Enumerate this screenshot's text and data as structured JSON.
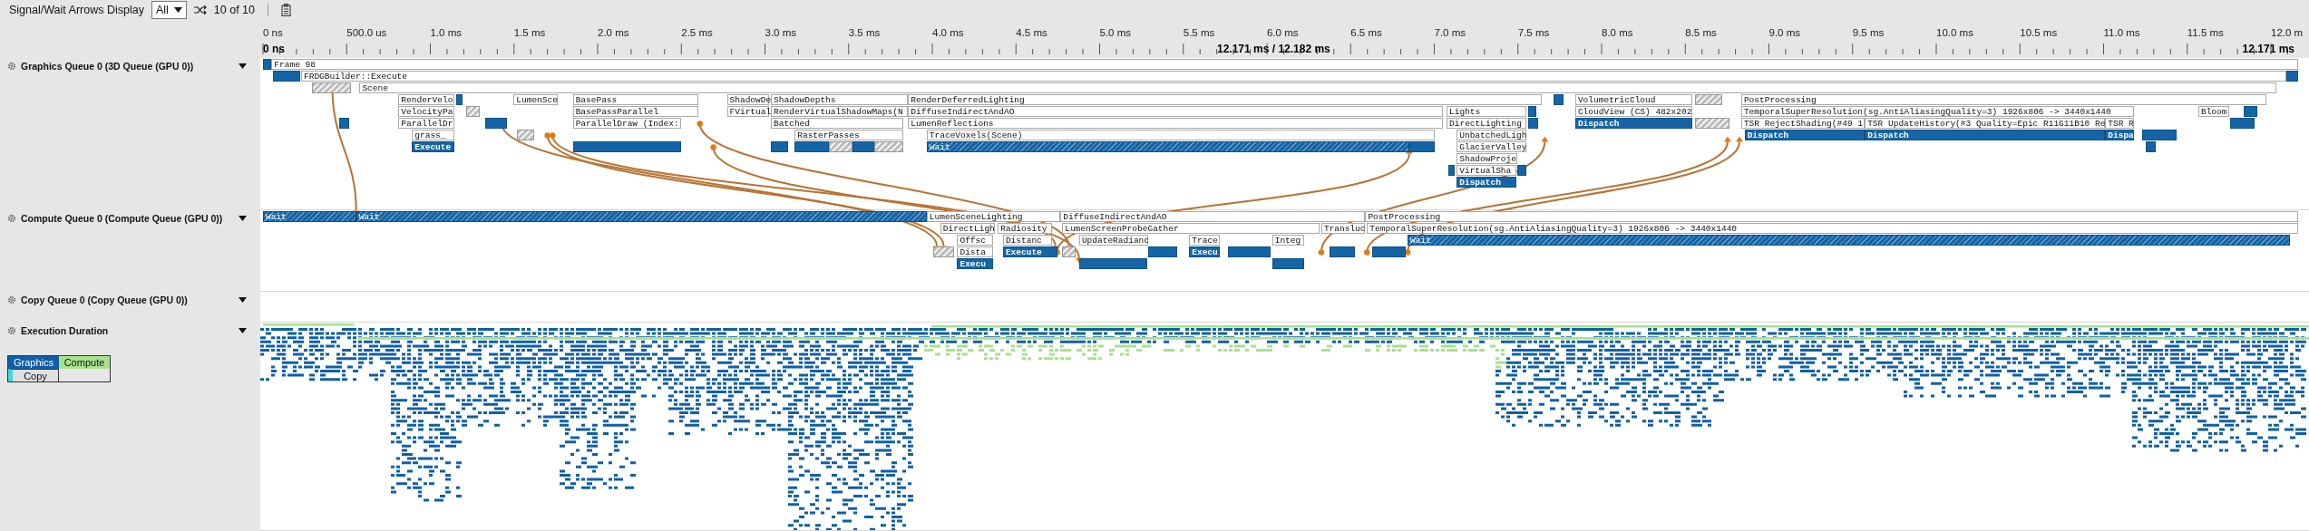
{
  "toolbar": {
    "label": "Signal/Wait Arrows Display",
    "filter": {
      "value": "All"
    },
    "arrow_count": "10 of 10"
  },
  "ruler": {
    "ticks": [
      "0 ns",
      "500.0 us",
      "1.0 ms",
      "1.5 ms",
      "2.0 ms",
      "2.5 ms",
      "3.0 ms",
      "3.5 ms",
      "4.0 ms",
      "4.5 ms",
      "5.0 ms",
      "5.5 ms",
      "6.0 ms",
      "6.5 ms",
      "7.0 ms",
      "7.5 ms",
      "8.0 ms",
      "8.5 ms",
      "9.0 ms",
      "9.5 ms",
      "10.0 ms",
      "10.5 ms",
      "11.0 ms",
      "11.5 ms",
      "12.0 m"
    ],
    "start_label": "0 ns",
    "range_label": "12.171 ms / 12.182 ms",
    "end_label": "12.171 ms"
  },
  "queues": [
    {
      "kind": "timeline",
      "title": "Graphics Queue 0 (3D Queue (GPU 0))",
      "expanded": true,
      "events": [
        {
          "kind": "pass",
          "label": "Frame 98"
        },
        {
          "kind": "pass",
          "label": "FRDGBuilder::Execute"
        },
        {
          "kind": "pass",
          "label": "Scene"
        },
        {
          "kind": "pass",
          "label": "RenderVelo"
        },
        {
          "kind": "pass",
          "label": "LumenSce"
        },
        {
          "kind": "pass",
          "label": "BasePass"
        },
        {
          "kind": "pass",
          "label": "ShadowDe"
        },
        {
          "kind": "pass",
          "label": "ShadowDepths"
        },
        {
          "kind": "pass",
          "label": "RenderDeferredLighting"
        },
        {
          "kind": "pass",
          "label": "VolumetricCloud"
        },
        {
          "kind": "pass",
          "label": "PostProcessing"
        },
        {
          "kind": "pass",
          "label": "VelocityPa"
        },
        {
          "kind": "pass",
          "label": "BasePassParallel"
        },
        {
          "kind": "pass",
          "label": "FVirtual"
        },
        {
          "kind": "pass",
          "label": "RenderVirtualShadowMaps(N"
        },
        {
          "kind": "pass",
          "label": "DiffuseIndirectAndAO"
        },
        {
          "kind": "pass",
          "label": "Lights"
        },
        {
          "kind": "pass",
          "label": "CloudView (CS) 482x202"
        },
        {
          "kind": "pass",
          "label": "TemporalSuperResolution(sg.AntiAliasingQuality=3) 1926x806 -> 3440x1440"
        },
        {
          "kind": "pass",
          "label": "Bloom"
        },
        {
          "kind": "pass",
          "label": "ParallelDr"
        },
        {
          "kind": "pass",
          "label": "ParallelDraw (Index:"
        },
        {
          "kind": "pass",
          "label": "Batched"
        },
        {
          "kind": "pass",
          "label": "LumenReflections"
        },
        {
          "kind": "pass",
          "label": "DirectLighting"
        },
        {
          "kind": "busy",
          "label": "Dispatch"
        },
        {
          "kind": "pass",
          "label": "TSR RejectShading(#49 1"
        },
        {
          "kind": "pass",
          "label": "TSR UpdateHistory(#3 Quality=Epic R11G11B10 Re"
        },
        {
          "kind": "pass",
          "label": "TSR R"
        },
        {
          "kind": "pass",
          "label": "grass_"
        },
        {
          "kind": "pass",
          "label": "RasterPasses"
        },
        {
          "kind": "pass",
          "label": "TraceVoxels(Scene)"
        },
        {
          "kind": "pass",
          "label": "UnbatchedLigh"
        },
        {
          "kind": "busy",
          "label": "Dispatch"
        },
        {
          "kind": "busy",
          "label": "Dispatch"
        },
        {
          "kind": "busy",
          "label": "Dispa"
        },
        {
          "kind": "busy",
          "label": "Execute"
        },
        {
          "kind": "wait",
          "label": "Wait"
        },
        {
          "kind": "pass",
          "label": "GlacierValley"
        },
        {
          "kind": "pass",
          "label": "ShadowProje"
        },
        {
          "kind": "pass",
          "label": "VirtualSha"
        },
        {
          "kind": "busy",
          "label": "Dispatch"
        }
      ]
    },
    {
      "kind": "timeline",
      "title": "Compute Queue 0 (Compute Queue (GPU 0))",
      "expanded": true,
      "events": [
        {
          "kind": "wait",
          "label": "Wait"
        },
        {
          "kind": "wait",
          "label": "Wait"
        },
        {
          "kind": "pass",
          "label": "LumenSceneLighting"
        },
        {
          "kind": "pass",
          "label": "DiffuseIndirectAndAO"
        },
        {
          "kind": "pass",
          "label": "PostProcessing"
        },
        {
          "kind": "pass",
          "label": "DirectLigh"
        },
        {
          "kind": "pass",
          "label": "Radiosity"
        },
        {
          "kind": "pass",
          "label": "LumenScreenProbeGather"
        },
        {
          "kind": "pass",
          "label": "Transluc"
        },
        {
          "kind": "pass",
          "label": "TemporalSuperResolution(sg.AntiAliasingQuality=3) 1926x806 -> 3440x1440"
        },
        {
          "kind": "pass",
          "label": "Offsc"
        },
        {
          "kind": "pass",
          "label": "Distanc"
        },
        {
          "kind": "pass",
          "label": "UpdateRadianc"
        },
        {
          "kind": "pass",
          "label": "Trace"
        },
        {
          "kind": "pass",
          "label": "Integ"
        },
        {
          "kind": "wait",
          "label": "Wait"
        },
        {
          "kind": "pass",
          "label": "Dista"
        },
        {
          "kind": "busy",
          "label": "Execute"
        },
        {
          "kind": "busy",
          "label": "Execu"
        },
        {
          "kind": "busy",
          "label": "Execu"
        }
      ]
    },
    {
      "kind": "timeline",
      "title": "Copy Queue 0 (Copy Queue (GPU 0))",
      "expanded": true
    },
    {
      "kind": "duration",
      "title": "Execution Duration",
      "expanded": true,
      "legend": [
        {
          "label": "Graphics",
          "color": "#0f5fa8"
        },
        {
          "label": "Compute",
          "color": "#a8e28c"
        },
        {
          "label": "Copy",
          "color": "#40d8d8"
        }
      ]
    }
  ]
}
